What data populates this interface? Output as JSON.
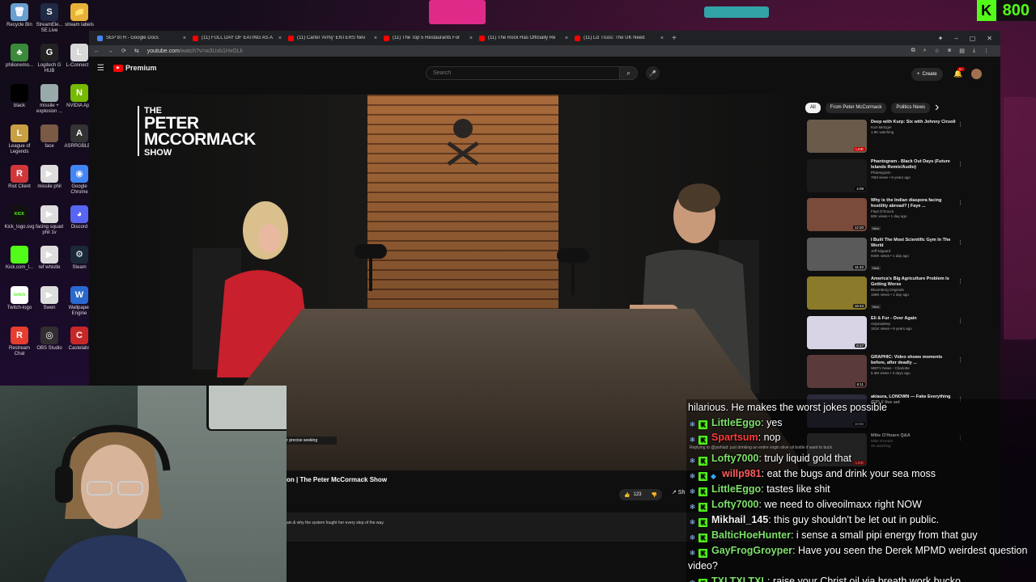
{
  "desktop": {
    "icons": [
      {
        "label": "Recycle Bin",
        "color": "#6aa0d0",
        "glyph": "🗑"
      },
      {
        "label": "StreamEle... SE.Live",
        "color": "#1f2a45",
        "glyph": "S"
      },
      {
        "label": "stream labels",
        "color": "#e8b23a",
        "glyph": "📁"
      },
      {
        "label": "philionemo...",
        "color": "#3a8a3a",
        "glyph": "♣"
      },
      {
        "label": "Logitech G HUB",
        "color": "#222",
        "glyph": "G"
      },
      {
        "label": "L-Connect 3",
        "color": "#d8d8d8",
        "glyph": "L"
      },
      {
        "label": "black",
        "color": "#000",
        "glyph": ""
      },
      {
        "label": "missile + explosion ...",
        "color": "#9aa",
        "glyph": ""
      },
      {
        "label": "NVIDIA App",
        "color": "#76b900",
        "glyph": "N"
      },
      {
        "label": "League of Legends",
        "color": "#c8a043",
        "glyph": "L"
      },
      {
        "label": "face",
        "color": "#7a5a45",
        "glyph": ""
      },
      {
        "label": "ASRRGBLED",
        "color": "#333",
        "glyph": "A"
      },
      {
        "label": "Riot Client",
        "color": "#d13639",
        "glyph": "R"
      },
      {
        "label": "missile phil",
        "color": "#ddd",
        "glyph": "▶"
      },
      {
        "label": "Google Chrome",
        "color": "#4285f4",
        "glyph": "◉"
      },
      {
        "label": "Kick_logo.svg",
        "color": "#111",
        "glyph": "KICK"
      },
      {
        "label": "facing squad phil 1v",
        "color": "#ddd",
        "glyph": "▶"
      },
      {
        "label": "Discord",
        "color": "#5865f2",
        "glyph": "◕"
      },
      {
        "label": "Kick.com_l...",
        "color": "#53fc18",
        "glyph": "KICK"
      },
      {
        "label": "ref whistle",
        "color": "#ddd",
        "glyph": "▶"
      },
      {
        "label": "Steam",
        "color": "#1b2838",
        "glyph": "⚙"
      },
      {
        "label": "Twitch-logo",
        "color": "#fff",
        "glyph": "twitch"
      },
      {
        "label": "Swen",
        "color": "#ddd",
        "glyph": "▶"
      },
      {
        "label": "Wallpaper Engine",
        "color": "#2a6ad0",
        "glyph": "W"
      },
      {
        "label": "Restream Chat",
        "color": "#e63d2f",
        "glyph": "R"
      },
      {
        "label": "OBS Studio",
        "color": "#302e31",
        "glyph": "◎"
      },
      {
        "label": "Castelabs",
        "color": "#c62828",
        "glyph": "C"
      }
    ],
    "kick_badge": {
      "logo": "K",
      "count": "800"
    }
  },
  "browser": {
    "tabs": [
      {
        "title": "SEP 8TH - Google Docs",
        "color": "#4285f4"
      },
      {
        "title": "(11) FULL DAY OF EATING AS A",
        "color": "#ff0000"
      },
      {
        "title": "(11) Cartel 'Army' ENTERS Nev",
        "color": "#ff0000"
      },
      {
        "title": "(11) The Top 5 Restaurants For",
        "color": "#ff0000"
      },
      {
        "title": "(11) The Rock Has Officially Re",
        "color": "#ff0000"
      },
      {
        "title": "(11) Liz Truss: The UK Need",
        "color": "#ff0000"
      }
    ],
    "tab_close": "×",
    "new_tab": "+",
    "window_controls": [
      "✦",
      "–",
      "▢",
      "✕"
    ],
    "nav": [
      "←",
      "→",
      "⟳",
      "⇆"
    ],
    "url_host": "youtube.com",
    "url_path": "/watch?v=w3Uxb1HxGLk",
    "addr_icons": [
      "⧉",
      "⌕",
      "☆",
      "⧈",
      "▤",
      "⤓",
      "⋮"
    ]
  },
  "youtube": {
    "menu": "☰",
    "logo_text": "Premium",
    "search_placeholder": "Search",
    "search_glyph": "⌕",
    "mic_glyph": "🎤",
    "create_label": "Create",
    "create_glyph": "+",
    "bell_glyph": "🔔",
    "bell_badge": "9+",
    "video": {
      "logo_line1": "THE",
      "logo_line2": "PETER",
      "logo_line3": "MCCORMACK",
      "logo_line4": "SHOW",
      "seek_tooltip": "⇧ Pull up for precise seeking"
    },
    "title_visible": "on | The Peter McCormack Show",
    "likes": "123",
    "like_glyph": "👍",
    "dislike_glyph": "👎",
    "share_glyph": "↗ Sh",
    "description": "ain & why the system fought her every step of the way.",
    "chips": [
      {
        "label": "All",
        "active": true
      },
      {
        "label": "From Peter McCormack",
        "active": false
      },
      {
        "label": "Politics News",
        "active": false
      }
    ],
    "chips_next": "›",
    "recommended": [
      {
        "title": "Deep with Kurp: Six with Johnny Ciruoli",
        "channel": "Kurt Metzger",
        "stats": "1.9K watching",
        "duration": "LIVE",
        "live": true,
        "new": false,
        "thumb": "#6a5a4a"
      },
      {
        "title": "Phantogram - Black Out Days (Future Islands Remix/Audio)",
        "channel": "Phantogram",
        "stats": "76M views • 8 years ago",
        "duration": "4:09",
        "live": false,
        "new": false,
        "thumb": "#1a1a1a"
      },
      {
        "title": "Why is the Indian diaspora facing hostility abroad? | Faye ...",
        "channel": "Faye D'Souza",
        "stats": "60K views • 1 day ago",
        "duration": "12:20",
        "live": false,
        "new": true,
        "thumb": "#7a4a3a"
      },
      {
        "title": "I Built The Most Scientific Gym In The World",
        "channel": "Jeff Nippard",
        "stats": "940K views • 1 day ago",
        "duration": "11:42",
        "live": false,
        "new": true,
        "thumb": "#5a5a5a"
      },
      {
        "title": "America's Big Agriculture Problem Is Getting Worse",
        "channel": "Bloomberg Originals",
        "stats": "166K views • 1 day ago",
        "duration": "18:43",
        "live": false,
        "new": true,
        "thumb": "#8a7a2a"
      },
      {
        "title": "Eli & Fur - Over Again",
        "channel": "Anjunadeep",
        "stats": "151K views • 9 years ago",
        "duration": "6:17",
        "live": false,
        "new": false,
        "thumb": "#d8d4e6"
      },
      {
        "title": "GRAPHIC: Video shows moments before, after deadly ...",
        "channel": "WBTV News - Charlotte",
        "stats": "6.3M views • 3 days ago",
        "duration": "6:11",
        "live": false,
        "new": false,
        "thumb": "#5a3a3a"
      },
      {
        "title": "akiaura, LONOWN — Fake Everything (EP) // live set",
        "channel": "",
        "stats": "",
        "duration": "18:55",
        "live": false,
        "new": false,
        "thumb": "#2a2a3a"
      },
      {
        "title": "Mike O'Hearn Q&A",
        "channel": "Mike O'Hearn",
        "stats": "4K watching",
        "duration": "LIVE",
        "live": true,
        "new": false,
        "thumb": "#3a3a3a"
      }
    ]
  },
  "chat": {
    "continuation": "hilarious. He makes the worst jokes possible",
    "reply_note": "Replying to @joshlud: just drinking an entire virgin olive oil bottle if want to buck",
    "messages": [
      {
        "user": "LittleEggo",
        "color": "#7ee16b",
        "text": "yes",
        "gem": false
      },
      {
        "user": "Spartsum",
        "color": "#ff3c3c",
        "text": "nop",
        "gem": false
      },
      {
        "user": "Lofty7000",
        "color": "#7ee16b",
        "text": "truly liquid gold that",
        "gem": false
      },
      {
        "user": "willp981",
        "color": "#ff5d5d",
        "text": "eat the bugs and drink your sea moss",
        "gem": true
      },
      {
        "user": "LittleEggo",
        "color": "#7ee16b",
        "text": "tastes like shit",
        "gem": false
      },
      {
        "user": "Lofty7000",
        "color": "#7ee16b",
        "text": "we need to oliveoilmaxx right NOW",
        "gem": false
      },
      {
        "user": "Mikhail_145",
        "color": "#f0f0f0",
        "text": "this guy shouldn't be let out in public.",
        "gem": false
      },
      {
        "user": "BalticHoeHunter",
        "color": "#7ee16b",
        "text": "i sense a small pipi energy from that guy",
        "gem": false
      },
      {
        "user": "GayFrogGroyper",
        "color": "#7ee16b",
        "text": "Have you seen the Derek MPMD weirdest question video?",
        "gem": false
      },
      {
        "user": "TXLTXLTXL",
        "color": "#7ee16b",
        "text": "raise your Christ oil via breath work bucko",
        "gem": false
      }
    ]
  }
}
